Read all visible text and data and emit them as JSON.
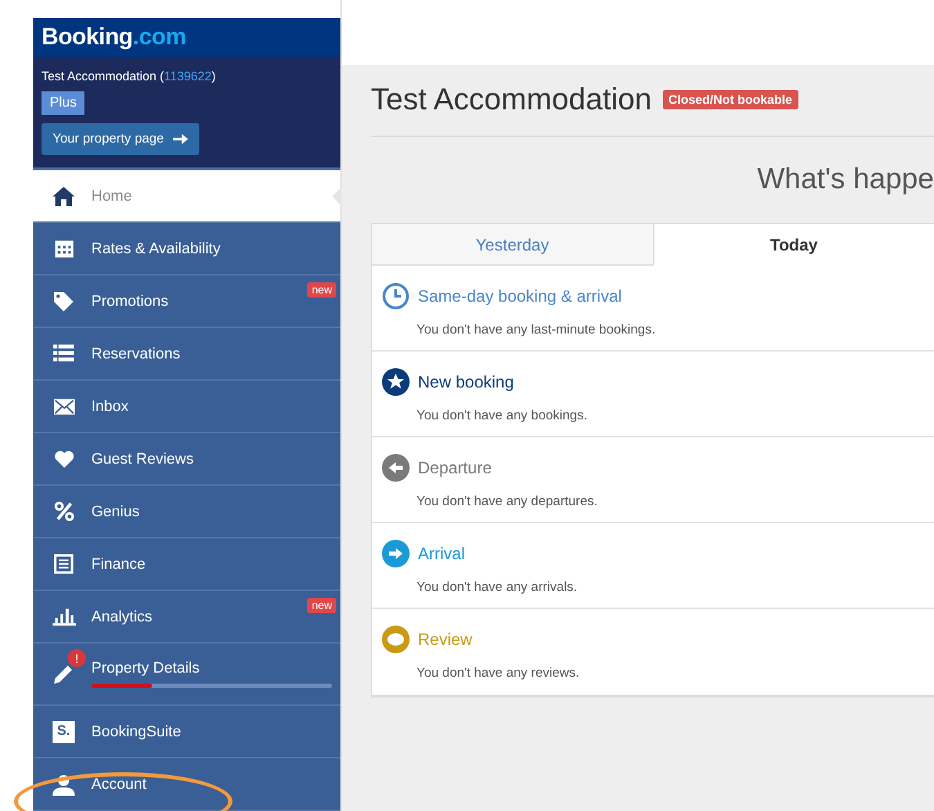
{
  "logo": {
    "brand": "Booking",
    "suffix": ".com"
  },
  "property": {
    "name": "Test Accommodation (",
    "id": "1139622",
    "close": ")",
    "plan": "Plus",
    "page_button": "Your property page"
  },
  "sidebar": {
    "items": [
      {
        "label": "Home",
        "kind": "home",
        "selected": true
      },
      {
        "label": "Rates & Availability",
        "kind": "calendar",
        "selected": false
      },
      {
        "label": "Promotions",
        "kind": "tag",
        "selected": false,
        "badge": "new"
      },
      {
        "label": "Reservations",
        "kind": "list",
        "selected": false
      },
      {
        "label": "Inbox",
        "kind": "mail",
        "selected": false
      },
      {
        "label": "Guest Reviews",
        "kind": "heart",
        "selected": false
      },
      {
        "label": "Genius",
        "kind": "percent",
        "selected": false
      },
      {
        "label": "Finance",
        "kind": "ledger",
        "selected": false
      },
      {
        "label": "Analytics",
        "kind": "bars",
        "selected": false,
        "badge": "new"
      },
      {
        "label": "Property Details",
        "kind": "pencil",
        "selected": false,
        "alert": "!",
        "level": 0.25
      },
      {
        "label": "BookingSuite",
        "kind": "suite",
        "suite_letter": "S.",
        "selected": false
      },
      {
        "label": "Account",
        "kind": "user",
        "selected": false
      }
    ]
  },
  "header": {
    "title": "Test Accommodation",
    "status": "Closed/Not bookable"
  },
  "section_heading": "What's happe",
  "tabs": [
    {
      "label": "Yesterday",
      "selected": false
    },
    {
      "label": "Today",
      "selected": true
    }
  ],
  "events": [
    {
      "title": "Same-day booking & arrival",
      "kind": "clock",
      "color": "#4a86c8",
      "message": "You don't have any last-minute bookings."
    },
    {
      "title": "New booking",
      "kind": "star",
      "color": "#0c3b7c",
      "message": "You don't have any bookings."
    },
    {
      "title": "Departure",
      "kind": "left",
      "color": "#7a7a7a",
      "message": "You don't have any departures."
    },
    {
      "title": "Arrival",
      "kind": "right",
      "color": "#1a9ad6",
      "message": "You don't have any arrivals."
    },
    {
      "title": "Review",
      "kind": "bubble",
      "color": "#c99a14",
      "message": "You don't have any reviews."
    }
  ],
  "annotation": {
    "kind": "ellipse"
  }
}
